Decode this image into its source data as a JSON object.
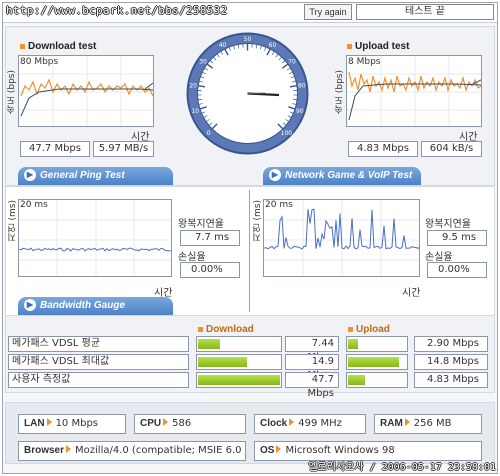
{
  "url": "http://www.bcpark.net/bbs/258532",
  "header": {
    "try_again": "Try again",
    "title": "테스트 끝"
  },
  "download": {
    "title": "Download test",
    "scale": "80 Mbps",
    "ylabel": "속도 (bps)",
    "xlabel": "시간",
    "mbps": "47.7 Mbps",
    "mbs": "5.97 MB/s"
  },
  "upload": {
    "title": "Upload test",
    "scale": "8 Mbps",
    "ylabel": "속도 (bps)",
    "xlabel": "시간",
    "mbps": "4.83 Mbps",
    "kbs": "604 kB/s"
  },
  "ping": {
    "tab": "General Ping Test",
    "scale": "20 ms",
    "ylabel": "지연 (ms)",
    "xlabel": "시간",
    "rtt_label": "왕복지연율",
    "rtt": "7.7 ms",
    "loss_label": "손실율",
    "loss": "0.00%"
  },
  "game": {
    "tab": "Network Game & VoIP Test",
    "scale": "20 ms",
    "ylabel": "지연 (ms)",
    "xlabel": "시간",
    "rtt_label": "왕복지연율",
    "rtt": "9.5 ms",
    "loss_label": "손실율",
    "loss": "0.00%"
  },
  "bandwidth": {
    "tab": "Bandwidth Gauge",
    "download_header": "Download",
    "upload_header": "Upload",
    "rows": [
      {
        "label": "메가패스 VDSL 평균",
        "down": "7.44 Mbps",
        "down_frac": 0.27,
        "up": "2.90 Mbps",
        "up_frac": 0.18
      },
      {
        "label": "메가패스 VDSL 최대값",
        "down": "14.9 Mbps",
        "down_frac": 0.6,
        "up": "14.8 Mbps",
        "up_frac": 0.88
      },
      {
        "label": "사용자 측정값",
        "down": "47.7 Mbps",
        "down_frac": 1.0,
        "up": "4.83 Mbps",
        "up_frac": 0.3
      }
    ]
  },
  "info": {
    "lan_key": "LAN",
    "lan": "10 Mbps",
    "cpu_key": "CPU",
    "cpu": "586",
    "clock_key": "Clock",
    "clock": "499 MHz",
    "ram_key": "RAM",
    "ram": "256 MB",
    "browser_key": "Browser",
    "browser": "Mozilla/4.0 (compatible; MSIE 6.0",
    "os_key": "OS",
    "os": "Microsoft Windows 98"
  },
  "footer": "엘로리사오사 / 2006-05-17 23:58:01",
  "gauge": {
    "ticks": [
      "0",
      "10",
      "20",
      "30",
      "40",
      "50",
      "60",
      "70",
      "80",
      "90",
      "100"
    ]
  },
  "colors": {
    "orange": "#f0922d",
    "blue": "#4b82c8",
    "green": "#8cc21f"
  }
}
